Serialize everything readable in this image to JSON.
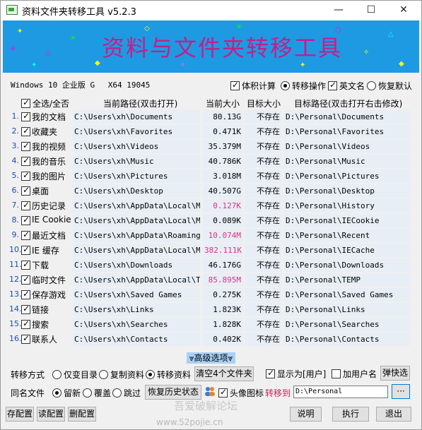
{
  "window": {
    "title": "资料文件夹转移工具 v5.2.3",
    "minimize": "—",
    "maximize": "☐",
    "close": "✕"
  },
  "banner": {
    "title": "资料与文件夹转移工具"
  },
  "sysinfo": {
    "os": "Windows 10 企业版 G",
    "arch": "X64 19045"
  },
  "options": {
    "volume_calc": "体积计算",
    "transfer_op": "转移操作",
    "english_name": "英文名",
    "restore_default": "恢复默认"
  },
  "headers": {
    "select_all": "全选/全否",
    "current_path": "当前路径(双击打开)",
    "current_size": "当前大小",
    "target_size": "目标大小",
    "target_path": "目标路径(双击打开右击修改)"
  },
  "rows": [
    {
      "num": "1.",
      "name": "我的文档",
      "path": "C:\\Users\\xh\\Documents",
      "size": "80.13G",
      "tsize": "不存在",
      "tpath": "D:\\Personal\\Documents",
      "pink": false
    },
    {
      "num": "2.",
      "name": "收藏夹",
      "path": "C:\\Users\\xh\\Favorites",
      "size": "0.471K",
      "tsize": "不存在",
      "tpath": "D:\\Personal\\Favorites",
      "pink": false
    },
    {
      "num": "3.",
      "name": "我的视频",
      "path": "C:\\Users\\xh\\Videos",
      "size": "35.379M",
      "tsize": "不存在",
      "tpath": "D:\\Personal\\Videos",
      "pink": false
    },
    {
      "num": "4.",
      "name": "我的音乐",
      "path": "C:\\Users\\xh\\Music",
      "size": "40.786K",
      "tsize": "不存在",
      "tpath": "D:\\Personal\\Music",
      "pink": false
    },
    {
      "num": "5.",
      "name": "我的图片",
      "path": "C:\\Users\\xh\\Pictures",
      "size": "3.018M",
      "tsize": "不存在",
      "tpath": "D:\\Personal\\Pictures",
      "pink": false
    },
    {
      "num": "6.",
      "name": "桌面",
      "path": "C:\\Users\\xh\\Desktop",
      "size": "40.507G",
      "tsize": "不存在",
      "tpath": "D:\\Personal\\Desktop",
      "pink": false
    },
    {
      "num": "7.",
      "name": "历史记录",
      "path": "C:\\Users\\xh\\AppData\\Local\\Micr",
      "size": "0.127K",
      "tsize": "不存在",
      "tpath": "D:\\Personal\\History",
      "pink": true
    },
    {
      "num": "8.",
      "name": "IE Cookie",
      "path": "C:\\Users\\xh\\AppData\\Local\\Micr",
      "size": "0.089K",
      "tsize": "不存在",
      "tpath": "D:\\Personal\\IECookie",
      "pink": false
    },
    {
      "num": "9.",
      "name": "最近文档",
      "path": "C:\\Users\\xh\\AppData\\Roaming\\Mi",
      "size": "10.074M",
      "tsize": "不存在",
      "tpath": "D:\\Personal\\Recent",
      "pink": true
    },
    {
      "num": "10.",
      "name": "IE 缓存",
      "path": "C:\\Users\\xh\\AppData\\Local\\Micr",
      "size": "382.111K",
      "tsize": "不存在",
      "tpath": "D:\\Personal\\IECache",
      "pink": true
    },
    {
      "num": "11.",
      "name": "下载",
      "path": "C:\\Users\\xh\\Downloads",
      "size": "46.176G",
      "tsize": "不存在",
      "tpath": "D:\\Personal\\Downloads",
      "pink": false
    },
    {
      "num": "12.",
      "name": "临时文件",
      "path": "C:\\Users\\xh\\AppData\\Local\\Temp",
      "size": "85.895M",
      "tsize": "不存在",
      "tpath": "D:\\Personal\\TEMP",
      "pink": true
    },
    {
      "num": "13.",
      "name": "保存游戏",
      "path": "C:\\Users\\xh\\Saved Games",
      "size": "0.275K",
      "tsize": "不存在",
      "tpath": "D:\\Personal\\Saved Games",
      "pink": false
    },
    {
      "num": "14.",
      "name": "链接",
      "path": "C:\\Users\\xh\\Links",
      "size": "1.823K",
      "tsize": "不存在",
      "tpath": "D:\\Personal\\Links",
      "pink": false
    },
    {
      "num": "15.",
      "name": "搜索",
      "path": "C:\\Users\\xh\\Searches",
      "size": "1.828K",
      "tsize": "不存在",
      "tpath": "D:\\Personal\\Searches",
      "pink": false
    },
    {
      "num": "16.",
      "name": "联系人",
      "path": "C:\\Users\\xh\\Contacts",
      "size": "0.402K",
      "tsize": "不存在",
      "tpath": "D:\\Personal\\Contacts",
      "pink": false
    }
  ],
  "advanced": "⩔高级选项⩔",
  "transfer": {
    "label": "转移方式",
    "only_dir": "仅变目录",
    "copy": "复制资料",
    "move": "转移资料",
    "clear_btn": "清空4个文件夹",
    "show_user": "显示为[用户]",
    "add_username": "加用户名",
    "popup_btn": "弹快选"
  },
  "samename": {
    "label": "同名文件",
    "keep": "留新",
    "overwrite": "覆盖",
    "skip": "跳过",
    "restore_btn": "恢复历史状态",
    "avatar_icon": "头像图标",
    "move_to": "转移到",
    "target": "D:\\Personal",
    "browse": "···"
  },
  "footer": {
    "save_cfg": "存配置",
    "read_cfg": "读配置",
    "del_cfg": "删配置",
    "help": "说明",
    "run": "执行",
    "exit": "退出"
  },
  "watermark": {
    "line1": "吾爱破解论坛",
    "line2": "www.52pojie.cn"
  }
}
